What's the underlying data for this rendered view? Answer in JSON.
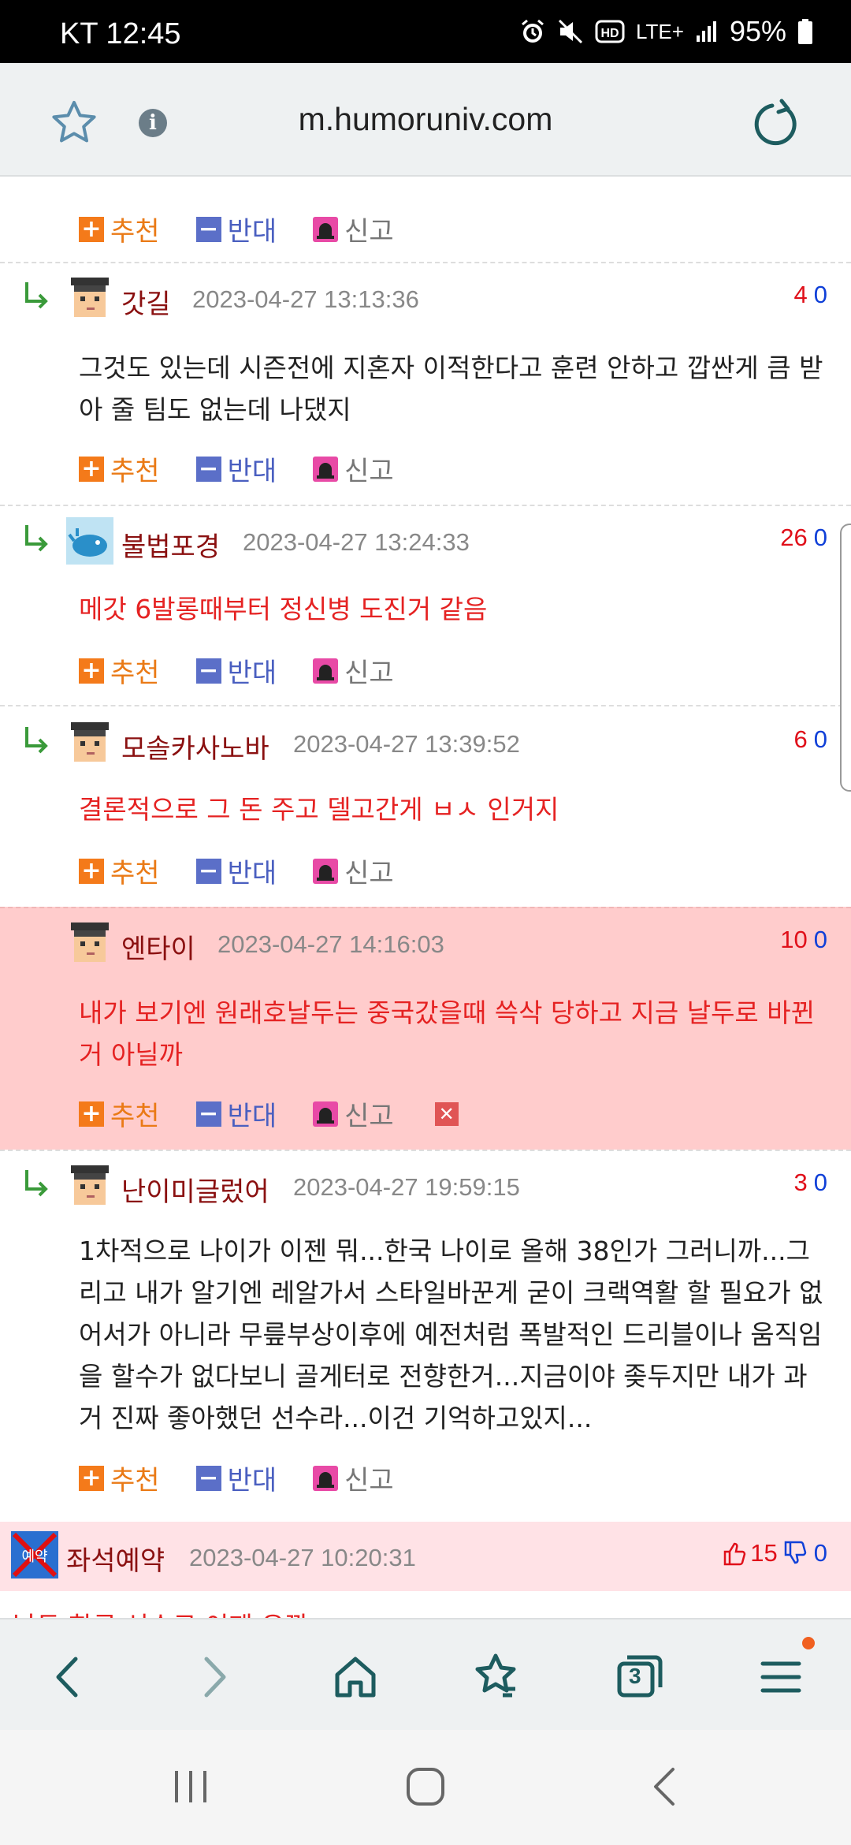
{
  "status_bar": {
    "carrier_time": "KT 12:45",
    "network": "LTE+",
    "battery": "95%",
    "icons": [
      "alarm-icon",
      "mute-icon",
      "hd-icon",
      "signal-icon",
      "battery-icon"
    ]
  },
  "url_bar": {
    "url": "m.humoruniv.com",
    "icons": [
      "star-icon",
      "info-icon",
      "reload-icon"
    ]
  },
  "actions": {
    "recommend": "추천",
    "oppose": "반대",
    "report": "신고"
  },
  "comments": [
    {
      "nick": "갓길",
      "date": "2023-04-27 13:13:36",
      "up": "4",
      "down": "0",
      "text": "그것도 있는데 시즌전에 지혼자 이적한다고 훈련 안하고 깝싼게 큼 받아 줄 팀도 없는데 나댔지"
    },
    {
      "nick": "불법포경",
      "date": "2023-04-27 13:24:33",
      "up": "26",
      "down": "0",
      "text": "메갓 6발롱때부터 정신병 도진거 같음"
    },
    {
      "nick": "모솔카사노바",
      "date": "2023-04-27 13:39:52",
      "up": "6",
      "down": "0",
      "text": "결론적으로 그 돈 주고 델고간게 ㅂㅅ 인거지"
    },
    {
      "nick": "엔타이",
      "date": "2023-04-27 14:16:03",
      "up": "10",
      "down": "0",
      "text": "내가 보기엔 원래호날두는 중국갔을때 쓱삭 당하고 지금 날두로 바뀐거 아닐까"
    },
    {
      "nick": "난이미글렀어",
      "date": "2023-04-27 19:59:15",
      "up": "3",
      "down": "0",
      "text": "1차적으로 나이가 이젠 뭐...한국 나이로 올해 38인가 그러니까...그리고 내가 알기엔 레알가서 스타일바꾼게 굳이 크랙역활 할 필요가 없어서가 아니라 무릎부상이후에 예전처럼 폭발적인 드리블이나 움직임을 할수가 없다보니 골게터로 전향한거...지금이야 좆두지만 내가 과거 진짜 좋아했던 선수라...이건 기억하고있지..."
    }
  ],
  "post_row": {
    "nick": "좌석예약",
    "date": "2023-04-27 10:20:31",
    "up": "15",
    "down": "0",
    "icon_label": "예약",
    "preview": "날두 한국 선수로 이제 유깡"
  },
  "toolbar": {
    "tabs_count": "3",
    "icons": [
      "back-icon",
      "forward-icon",
      "home-icon",
      "bookmarks-icon",
      "tabs-icon",
      "menu-icon"
    ]
  },
  "colors": {
    "highlight_bg": "#ffcccc",
    "post_row_bg": "#ffe2e6",
    "nick": "#8a1010",
    "red_text": "#e52222",
    "up_score": "#e0101a",
    "down_score": "#1040d8"
  }
}
